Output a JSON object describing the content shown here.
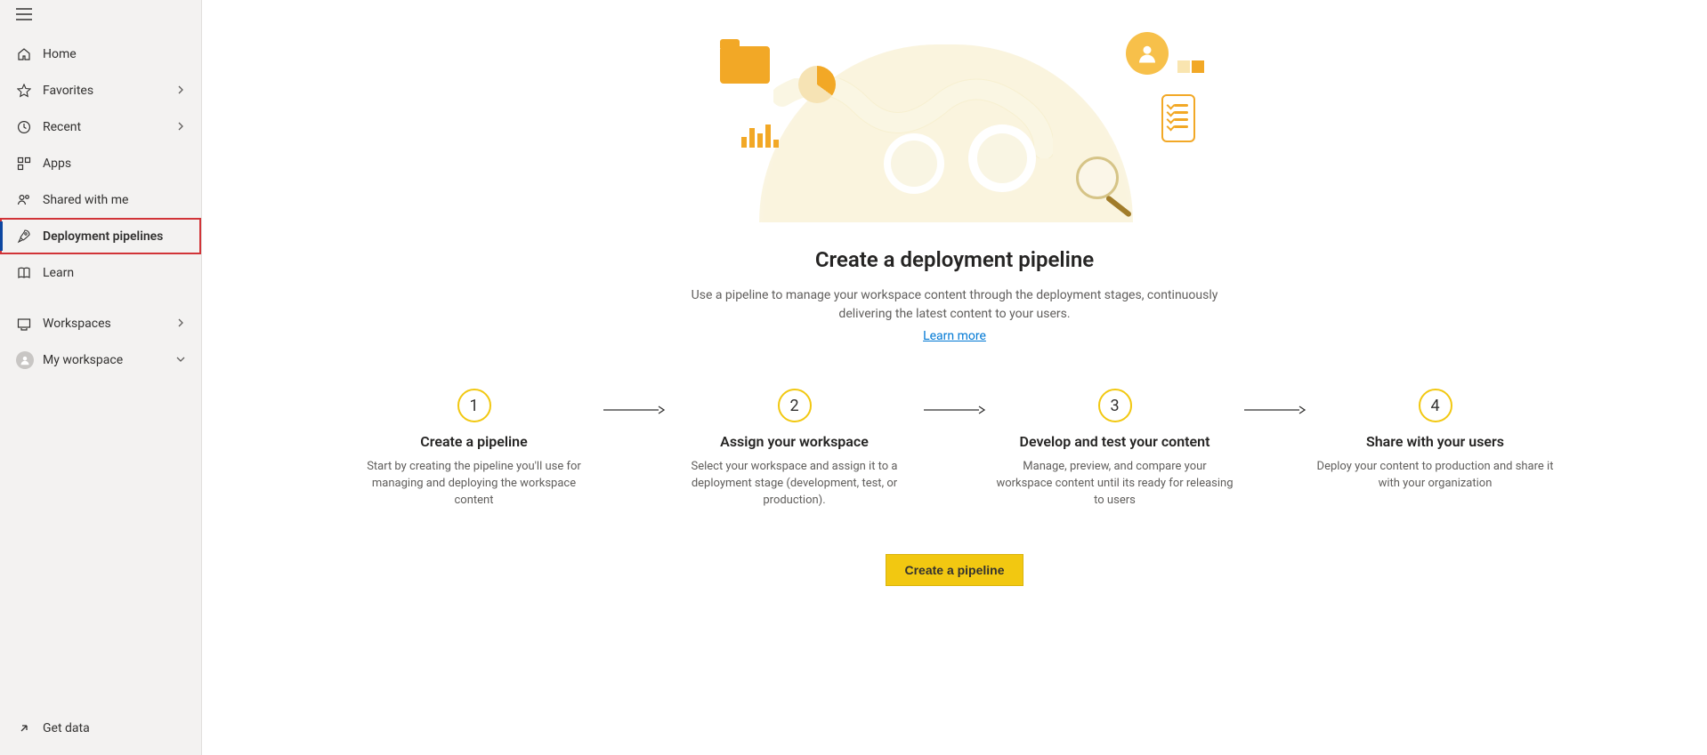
{
  "sidebar": {
    "items": {
      "home": {
        "label": "Home"
      },
      "favorites": {
        "label": "Favorites"
      },
      "recent": {
        "label": "Recent"
      },
      "apps": {
        "label": "Apps"
      },
      "shared": {
        "label": "Shared with me"
      },
      "pipelines": {
        "label": "Deployment pipelines"
      },
      "learn": {
        "label": "Learn"
      },
      "workspaces": {
        "label": "Workspaces"
      },
      "myws": {
        "label": "My workspace"
      },
      "getdata": {
        "label": "Get data"
      }
    }
  },
  "hero": {
    "title": "Create a deployment pipeline",
    "desc": "Use a pipeline to manage your workspace content through the deployment stages, continuously delivering the latest content to your users.",
    "learn": "Learn more"
  },
  "steps": [
    {
      "num": "1",
      "title": "Create a pipeline",
      "desc": "Start by creating the pipeline you'll use for managing and deploying the workspace content"
    },
    {
      "num": "2",
      "title": "Assign your workspace",
      "desc": "Select your workspace and assign it to a deployment stage (development, test, or production)."
    },
    {
      "num": "3",
      "title": "Develop and test your content",
      "desc": "Manage, preview, and compare your workspace content until its ready for releasing to users"
    },
    {
      "num": "4",
      "title": "Share with your users",
      "desc": "Deploy your content to production and share it with your organization"
    }
  ],
  "cta": {
    "label": "Create a pipeline"
  }
}
